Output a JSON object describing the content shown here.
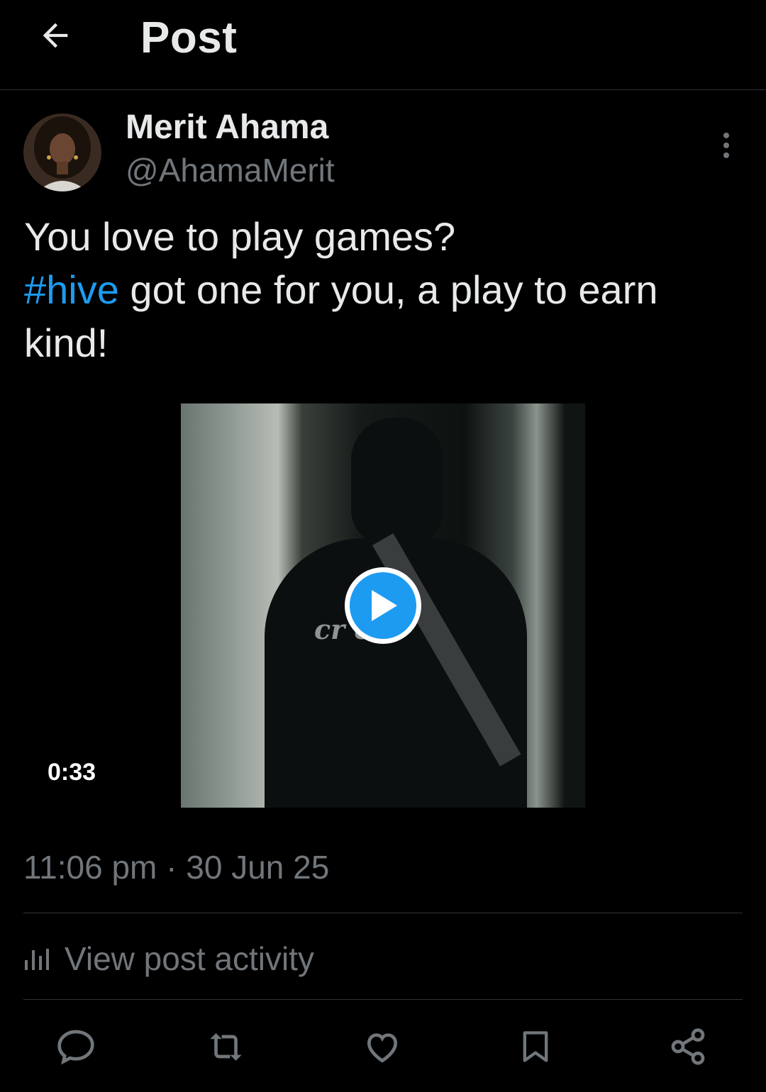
{
  "header": {
    "title": "Post",
    "back_icon": "arrow-left-icon"
  },
  "author": {
    "name": "Merit Ahama",
    "handle": "@AhamaMerit",
    "more_icon": "more-vertical-icon"
  },
  "post": {
    "text_line1": "You love to play games?",
    "hashtag": "#hive",
    "text_rest": " got one for you, a play to earn kind!",
    "timestamp": "11:06 pm · 30 Jun 25"
  },
  "media": {
    "type": "video",
    "duration": "0:33",
    "shirt_text": "cr   ent",
    "play_icon": "play-icon"
  },
  "activity": {
    "label": "View post activity",
    "icon": "bar-chart-icon"
  },
  "actions": {
    "reply_icon": "reply-icon",
    "repost_icon": "repost-icon",
    "like_icon": "heart-icon",
    "bookmark_icon": "bookmark-icon",
    "share_icon": "share-icon"
  },
  "colors": {
    "background": "#000000",
    "primary_text": "#e7e9ea",
    "secondary_text": "#71767b",
    "accent": "#1d9bf0",
    "divider": "#2f3336"
  }
}
